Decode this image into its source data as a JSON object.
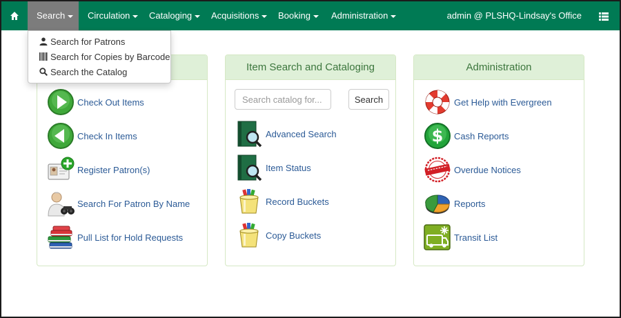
{
  "navbar": {
    "home_icon": "home-icon",
    "items": [
      {
        "label": "Search"
      },
      {
        "label": "Circulation"
      },
      {
        "label": "Cataloging"
      },
      {
        "label": "Acquisitions"
      },
      {
        "label": "Booking"
      },
      {
        "label": "Administration"
      }
    ],
    "user": "admin @ PLSHQ-Lindsay's Office",
    "menu_icon": "list-icon",
    "bg_color": "#007a54",
    "active_color": "#7c7c7c"
  },
  "search_dropdown": {
    "items": [
      {
        "label": "Search for Patrons",
        "icon": "user-icon"
      },
      {
        "label": "Search for Copies by Barcode",
        "icon": "barcode-icon"
      },
      {
        "label": "Search the Catalog",
        "icon": "magnifier-icon"
      }
    ]
  },
  "panels": {
    "circulation": {
      "title": "",
      "links": [
        {
          "label": "Check Out Items",
          "icon": "check-out-icon"
        },
        {
          "label": "Check In Items",
          "icon": "check-in-icon"
        },
        {
          "label": "Register Patron(s)",
          "icon": "register-patron-icon"
        },
        {
          "label": "Search For Patron By Name",
          "icon": "patron-binoculars-icon"
        },
        {
          "label": "Pull List for Hold Requests",
          "icon": "books-icon"
        }
      ]
    },
    "cataloging": {
      "title": "Item Search and Cataloging",
      "search_placeholder": "Search catalog for...",
      "search_button": "Search",
      "links": [
        {
          "label": "Advanced Search",
          "icon": "advanced-search-icon"
        },
        {
          "label": "Item Status",
          "icon": "item-status-icon"
        },
        {
          "label": "Record Buckets",
          "icon": "record-bucket-icon"
        },
        {
          "label": "Copy Buckets",
          "icon": "copy-bucket-icon"
        }
      ]
    },
    "administration": {
      "title": "Administration",
      "links": [
        {
          "label": "Get Help with Evergreen",
          "icon": "lifebuoy-icon"
        },
        {
          "label": "Cash Reports",
          "icon": "dollar-icon"
        },
        {
          "label": "Overdue Notices",
          "icon": "overdue-stamp-icon"
        },
        {
          "label": "Reports",
          "icon": "pie-chart-icon"
        },
        {
          "label": "Transit List",
          "icon": "transit-van-icon"
        }
      ]
    }
  }
}
